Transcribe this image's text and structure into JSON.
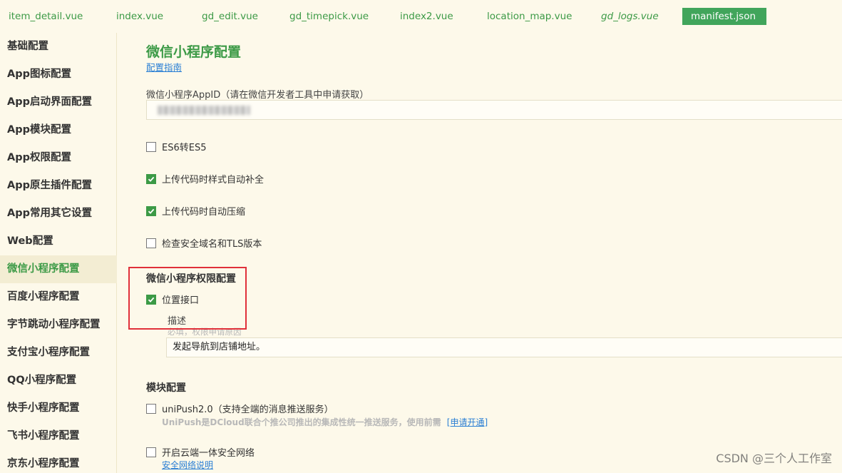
{
  "tabs": [
    {
      "label": "item_detail.vue",
      "active": false,
      "italic": false
    },
    {
      "label": "index.vue",
      "active": false,
      "italic": false
    },
    {
      "label": "gd_edit.vue",
      "active": false,
      "italic": false
    },
    {
      "label": "gd_timepick.vue",
      "active": false,
      "italic": false
    },
    {
      "label": "index2.vue",
      "active": false,
      "italic": false
    },
    {
      "label": "location_map.vue",
      "active": false,
      "italic": false
    },
    {
      "label": "gd_logs.vue",
      "active": false,
      "italic": true
    },
    {
      "label": "manifest.json",
      "active": true,
      "italic": false
    }
  ],
  "sidebar": {
    "items": [
      {
        "label": "基础配置"
      },
      {
        "label": "App图标配置"
      },
      {
        "label": "App启动界面配置"
      },
      {
        "label": "App模块配置"
      },
      {
        "label": "App权限配置"
      },
      {
        "label": "App原生插件配置"
      },
      {
        "label": "App常用其它设置"
      },
      {
        "label": "Web配置"
      },
      {
        "label": "微信小程序配置"
      },
      {
        "label": "百度小程序配置"
      },
      {
        "label": "字节跳动小程序配置"
      },
      {
        "label": "支付宝小程序配置"
      },
      {
        "label": "QQ小程序配置"
      },
      {
        "label": "快手小程序配置"
      },
      {
        "label": "飞书小程序配置"
      },
      {
        "label": "京东小程序配置"
      }
    ],
    "active_index": 8
  },
  "main": {
    "title": "微信小程序配置",
    "guide_link": "配置指南",
    "appid_label": "微信小程序AppID（请在微信开发者工具中申请获取）",
    "options": [
      {
        "label": "ES6转ES5",
        "checked": false
      },
      {
        "label": "上传代码时样式自动补全",
        "checked": true
      },
      {
        "label": "上传代码时自动压缩",
        "checked": true
      },
      {
        "label": "检查安全域名和TLS版本",
        "checked": false
      }
    ],
    "permission_section": "微信小程序权限配置",
    "location_label": "位置接口",
    "location_checked": true,
    "desc_label": "描述",
    "desc_hint": "必填，权限申请原因",
    "desc_value": "发起导航到店铺地址。",
    "module_section": "模块配置",
    "unipush_label": "uniPush2.0（支持全端的消息推送服务）",
    "unipush_checked": false,
    "unipush_desc": "UniPush是DCloud联合个推公司推出的集成性统一推送服务，使用前需",
    "unipush_link": "[申请开通]",
    "secure_label": "开启云端一体安全网络",
    "secure_checked": false,
    "secure_link": "安全网络说明"
  },
  "watermark": "CSDN @三个人工作室",
  "colors": {
    "accent": "#3c9a46",
    "active_tab": "#41a55b",
    "background": "#fdf9ea",
    "highlight_box": "#e0303a",
    "link": "#2a7fd4"
  }
}
